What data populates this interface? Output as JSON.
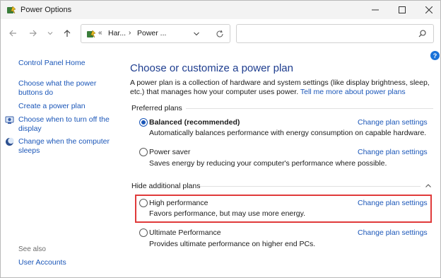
{
  "window": {
    "title": "Power Options"
  },
  "address": {
    "sep": "«",
    "crumbs": [
      "Har...",
      "Power ..."
    ],
    "arrow": "›"
  },
  "search": {
    "placeholder": ""
  },
  "help": {
    "label": "?"
  },
  "sidebar": {
    "items": [
      {
        "label": "Control Panel Home"
      },
      {
        "label": "Choose what the power buttons do"
      },
      {
        "label": "Create a power plan"
      },
      {
        "label": "Choose when to turn off the display"
      },
      {
        "label": "Change when the computer sleeps"
      }
    ],
    "see_also": "See also",
    "see_also_items": [
      {
        "label": "User Accounts"
      }
    ]
  },
  "main": {
    "title": "Choose or customize a power plan",
    "intro": "A power plan is a collection of hardware and system settings (like display brightness, sleep, etc.) that manages how your computer uses power. ",
    "intro_link": "Tell me more about power plans",
    "preferred_head": "Preferred plans",
    "hidden_head": "Hide additional plans",
    "change_label": "Change plan settings",
    "plans": [
      {
        "name": "Balanced (recommended)",
        "desc": "Automatically balances performance with energy consumption on capable hardware.",
        "selected": true
      },
      {
        "name": "Power saver",
        "desc": "Saves energy by reducing your computer's performance where possible.",
        "selected": false
      },
      {
        "name": "High performance",
        "desc": "Favors performance, but may use more energy.",
        "selected": false
      },
      {
        "name": "Ultimate Performance",
        "desc": "Provides ultimate performance on higher end PCs.",
        "selected": false
      }
    ]
  },
  "colors": {
    "link": "#1a56b8",
    "title": "#1e3d8f",
    "highlight": "#e03a3a"
  }
}
